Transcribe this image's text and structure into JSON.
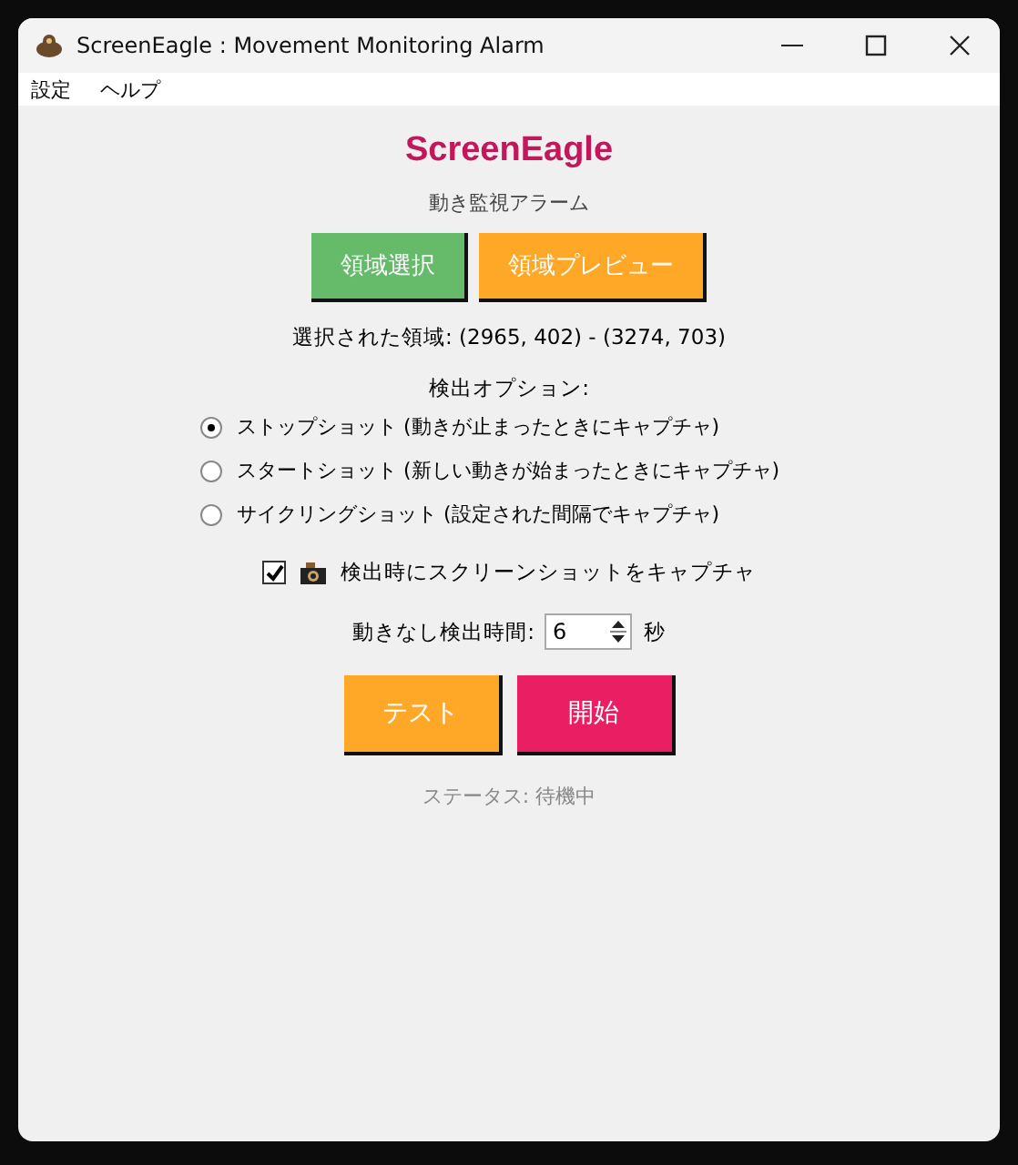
{
  "window": {
    "title": "ScreenEagle : Movement Monitoring Alarm"
  },
  "menu": [
    "設定",
    "ヘルプ"
  ],
  "app_title": "ScreenEagle",
  "subtitle": "動き監視アラーム",
  "region_buttons": [
    {
      "label": "領域選択",
      "color": "#66bb6a"
    },
    {
      "label": "領域プレビュー",
      "color": "#ffa726"
    }
  ],
  "selected_region": "選択された領域: (2965, 402) - (3274, 703)",
  "options_label": "検出オプション:",
  "options": [
    {
      "label": "ストップショット (動きが止まったときにキャプチャ)",
      "selected": true
    },
    {
      "label": "スタートショット (新しい動きが始まったときにキャプチャ)",
      "selected": false
    },
    {
      "label": "サイクリングショット (設定された間隔でキャプチャ)",
      "selected": false
    }
  ],
  "capture": {
    "label": "検出時にスクリーンショットをキャプチャ",
    "checked": true
  },
  "idle_time": {
    "label": "動きなし検出時間:",
    "value": "6",
    "unit": "秒"
  },
  "action_buttons": [
    {
      "label": "テスト",
      "color": "#ffa726"
    },
    {
      "label": "開始",
      "color": "#e91e63"
    }
  ],
  "status": "ステータス: 待機中"
}
